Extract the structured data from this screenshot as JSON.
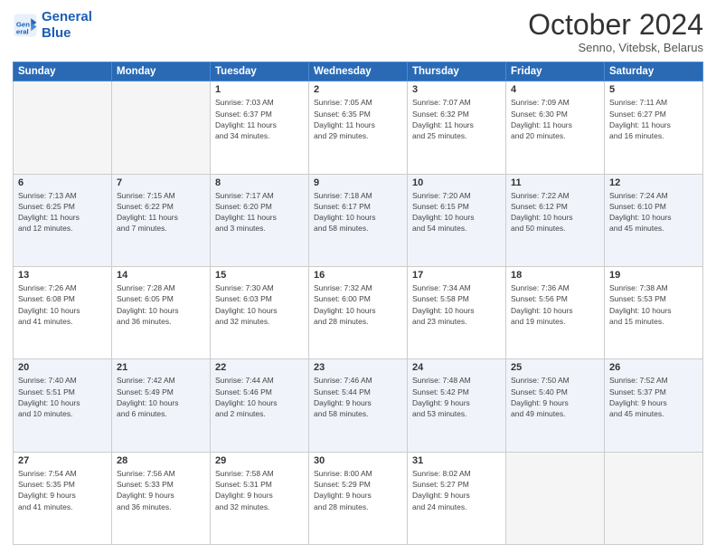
{
  "header": {
    "logo_line1": "General",
    "logo_line2": "Blue",
    "month": "October 2024",
    "location": "Senno, Vitebsk, Belarus"
  },
  "weekdays": [
    "Sunday",
    "Monday",
    "Tuesday",
    "Wednesday",
    "Thursday",
    "Friday",
    "Saturday"
  ],
  "weeks": [
    [
      {
        "day": "",
        "info": ""
      },
      {
        "day": "",
        "info": ""
      },
      {
        "day": "1",
        "info": "Sunrise: 7:03 AM\nSunset: 6:37 PM\nDaylight: 11 hours\nand 34 minutes."
      },
      {
        "day": "2",
        "info": "Sunrise: 7:05 AM\nSunset: 6:35 PM\nDaylight: 11 hours\nand 29 minutes."
      },
      {
        "day": "3",
        "info": "Sunrise: 7:07 AM\nSunset: 6:32 PM\nDaylight: 11 hours\nand 25 minutes."
      },
      {
        "day": "4",
        "info": "Sunrise: 7:09 AM\nSunset: 6:30 PM\nDaylight: 11 hours\nand 20 minutes."
      },
      {
        "day": "5",
        "info": "Sunrise: 7:11 AM\nSunset: 6:27 PM\nDaylight: 11 hours\nand 16 minutes."
      }
    ],
    [
      {
        "day": "6",
        "info": "Sunrise: 7:13 AM\nSunset: 6:25 PM\nDaylight: 11 hours\nand 12 minutes."
      },
      {
        "day": "7",
        "info": "Sunrise: 7:15 AM\nSunset: 6:22 PM\nDaylight: 11 hours\nand 7 minutes."
      },
      {
        "day": "8",
        "info": "Sunrise: 7:17 AM\nSunset: 6:20 PM\nDaylight: 11 hours\nand 3 minutes."
      },
      {
        "day": "9",
        "info": "Sunrise: 7:18 AM\nSunset: 6:17 PM\nDaylight: 10 hours\nand 58 minutes."
      },
      {
        "day": "10",
        "info": "Sunrise: 7:20 AM\nSunset: 6:15 PM\nDaylight: 10 hours\nand 54 minutes."
      },
      {
        "day": "11",
        "info": "Sunrise: 7:22 AM\nSunset: 6:12 PM\nDaylight: 10 hours\nand 50 minutes."
      },
      {
        "day": "12",
        "info": "Sunrise: 7:24 AM\nSunset: 6:10 PM\nDaylight: 10 hours\nand 45 minutes."
      }
    ],
    [
      {
        "day": "13",
        "info": "Sunrise: 7:26 AM\nSunset: 6:08 PM\nDaylight: 10 hours\nand 41 minutes."
      },
      {
        "day": "14",
        "info": "Sunrise: 7:28 AM\nSunset: 6:05 PM\nDaylight: 10 hours\nand 36 minutes."
      },
      {
        "day": "15",
        "info": "Sunrise: 7:30 AM\nSunset: 6:03 PM\nDaylight: 10 hours\nand 32 minutes."
      },
      {
        "day": "16",
        "info": "Sunrise: 7:32 AM\nSunset: 6:00 PM\nDaylight: 10 hours\nand 28 minutes."
      },
      {
        "day": "17",
        "info": "Sunrise: 7:34 AM\nSunset: 5:58 PM\nDaylight: 10 hours\nand 23 minutes."
      },
      {
        "day": "18",
        "info": "Sunrise: 7:36 AM\nSunset: 5:56 PM\nDaylight: 10 hours\nand 19 minutes."
      },
      {
        "day": "19",
        "info": "Sunrise: 7:38 AM\nSunset: 5:53 PM\nDaylight: 10 hours\nand 15 minutes."
      }
    ],
    [
      {
        "day": "20",
        "info": "Sunrise: 7:40 AM\nSunset: 5:51 PM\nDaylight: 10 hours\nand 10 minutes."
      },
      {
        "day": "21",
        "info": "Sunrise: 7:42 AM\nSunset: 5:49 PM\nDaylight: 10 hours\nand 6 minutes."
      },
      {
        "day": "22",
        "info": "Sunrise: 7:44 AM\nSunset: 5:46 PM\nDaylight: 10 hours\nand 2 minutes."
      },
      {
        "day": "23",
        "info": "Sunrise: 7:46 AM\nSunset: 5:44 PM\nDaylight: 9 hours\nand 58 minutes."
      },
      {
        "day": "24",
        "info": "Sunrise: 7:48 AM\nSunset: 5:42 PM\nDaylight: 9 hours\nand 53 minutes."
      },
      {
        "day": "25",
        "info": "Sunrise: 7:50 AM\nSunset: 5:40 PM\nDaylight: 9 hours\nand 49 minutes."
      },
      {
        "day": "26",
        "info": "Sunrise: 7:52 AM\nSunset: 5:37 PM\nDaylight: 9 hours\nand 45 minutes."
      }
    ],
    [
      {
        "day": "27",
        "info": "Sunrise: 7:54 AM\nSunset: 5:35 PM\nDaylight: 9 hours\nand 41 minutes."
      },
      {
        "day": "28",
        "info": "Sunrise: 7:56 AM\nSunset: 5:33 PM\nDaylight: 9 hours\nand 36 minutes."
      },
      {
        "day": "29",
        "info": "Sunrise: 7:58 AM\nSunset: 5:31 PM\nDaylight: 9 hours\nand 32 minutes."
      },
      {
        "day": "30",
        "info": "Sunrise: 8:00 AM\nSunset: 5:29 PM\nDaylight: 9 hours\nand 28 minutes."
      },
      {
        "day": "31",
        "info": "Sunrise: 8:02 AM\nSunset: 5:27 PM\nDaylight: 9 hours\nand 24 minutes."
      },
      {
        "day": "",
        "info": ""
      },
      {
        "day": "",
        "info": ""
      }
    ]
  ]
}
